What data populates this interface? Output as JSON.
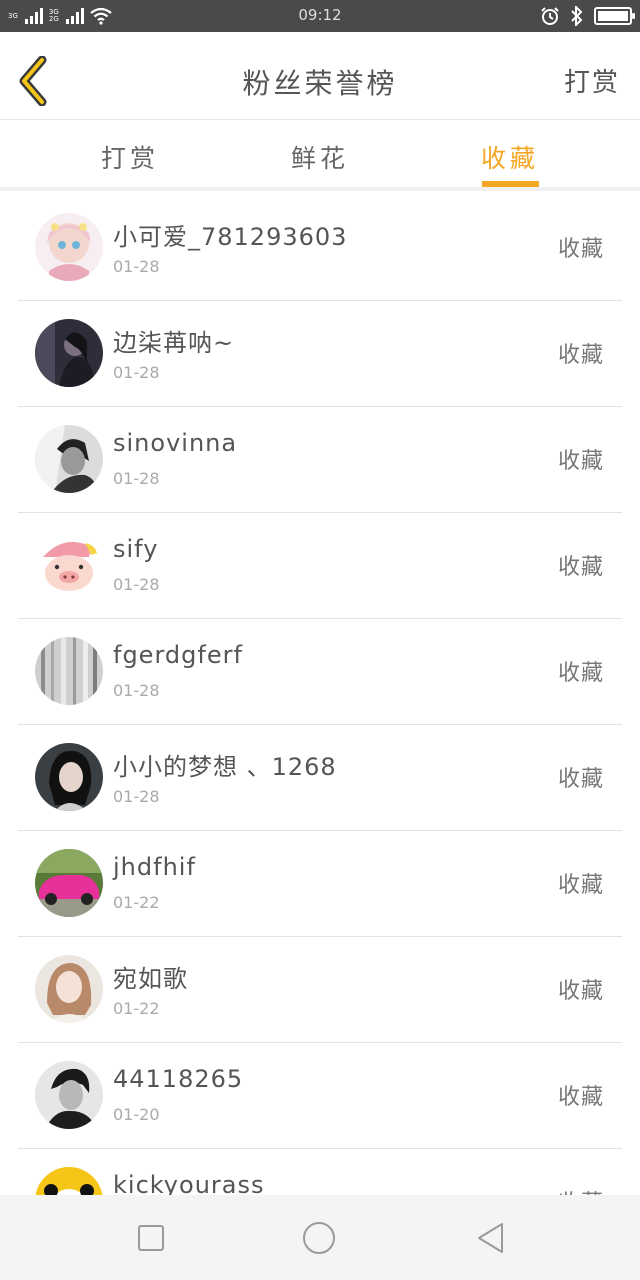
{
  "status_bar": {
    "time": "09:12",
    "signal_label_1": "3G",
    "signal_label_2a": "3G",
    "signal_label_2b": "2G",
    "icons": [
      "signal-icon",
      "signal-icon",
      "wifi-icon",
      "alarm-icon",
      "bluetooth-icon",
      "battery-icon"
    ]
  },
  "header": {
    "title": "粉丝荣誉榜",
    "action_label": "打赏",
    "back_icon": "chevron-left-icon"
  },
  "tabs": [
    {
      "label": "打赏",
      "active": false
    },
    {
      "label": "鲜花",
      "active": false
    },
    {
      "label": "收藏",
      "active": true
    }
  ],
  "colors": {
    "accent": "#f5a623",
    "status_bar": "#4a4a4a",
    "divider": "#e2e2e2",
    "nav_bg": "#f4f4f4"
  },
  "fans": [
    {
      "name": "小可爱_781293603",
      "date": "01-28",
      "action": "收藏",
      "avatar": "anime-girl-avatar"
    },
    {
      "name": "边柒苒呐~",
      "date": "01-28",
      "action": "收藏",
      "avatar": "dark-portrait-avatar"
    },
    {
      "name": "sinovinna",
      "date": "01-28",
      "action": "收藏",
      "avatar": "bw-portrait-avatar"
    },
    {
      "name": "sify",
      "date": "01-28",
      "action": "收藏",
      "avatar": "cartoon-pig-avatar"
    },
    {
      "name": "fgerdgferf",
      "date": "01-28",
      "action": "收藏",
      "avatar": "grey-curtain-avatar"
    },
    {
      "name": "小小的梦想 、1268",
      "date": "01-28",
      "action": "收藏",
      "avatar": "girl-portrait-avatar"
    },
    {
      "name": "jhdfhif",
      "date": "01-22",
      "action": "收藏",
      "avatar": "pink-car-avatar"
    },
    {
      "name": "宛如歌",
      "date": "01-22",
      "action": "收藏",
      "avatar": "girl-light-avatar"
    },
    {
      "name": "44118265",
      "date": "01-20",
      "action": "收藏",
      "avatar": "man-portrait-avatar"
    },
    {
      "name": "kickyourass",
      "date": "",
      "action": "收藏",
      "avatar": "panda-avatar"
    }
  ],
  "nav_bar": {
    "buttons": [
      "recent-apps-icon",
      "home-icon",
      "back-icon"
    ]
  }
}
